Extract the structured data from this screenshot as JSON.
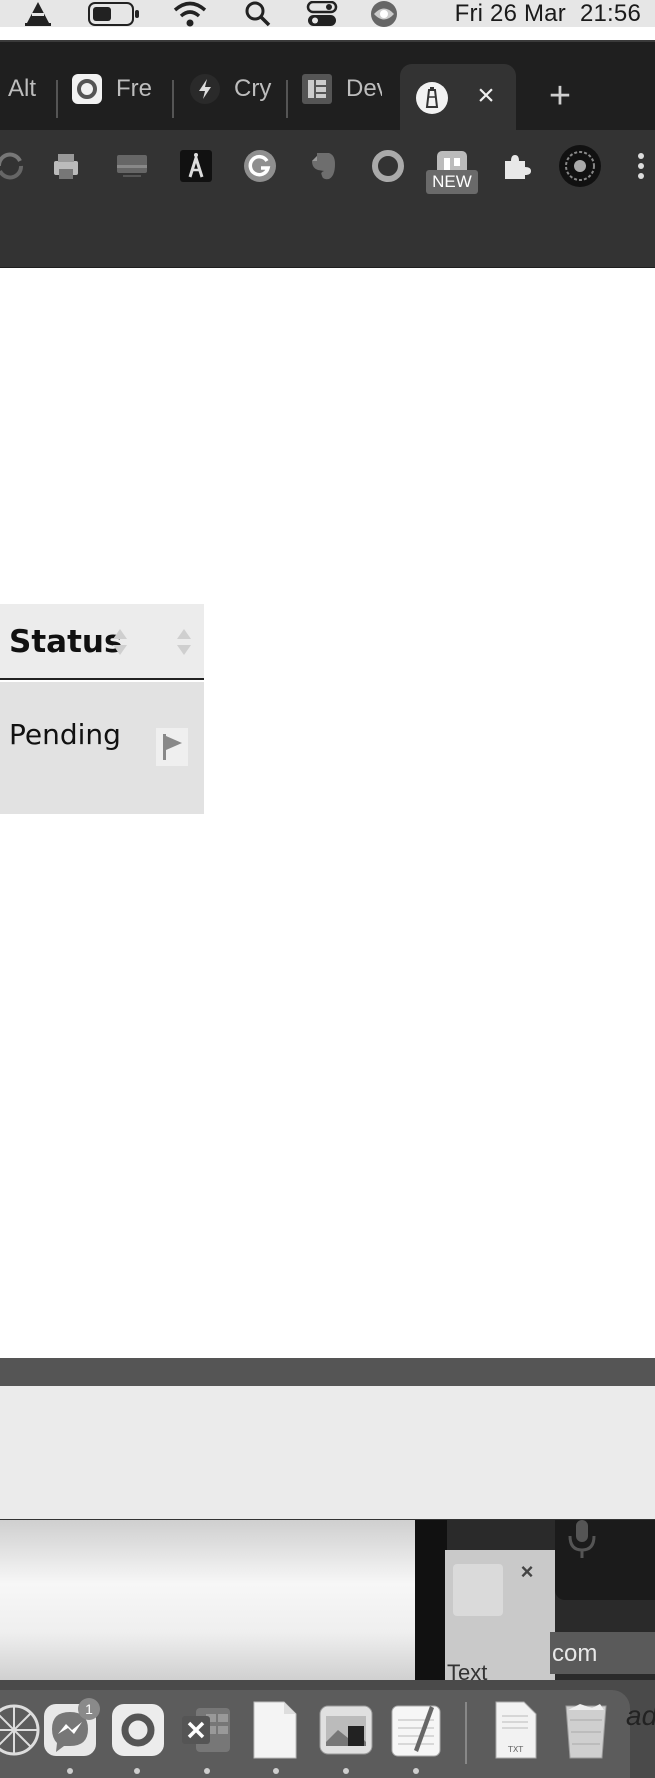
{
  "menubar": {
    "date": "Fri 26 Mar",
    "time": "21:56",
    "icons": [
      "vlc-icon",
      "battery-icon",
      "wifi-icon",
      "spotlight-search-icon",
      "control-center-icon",
      "siri-icon"
    ]
  },
  "browser": {
    "tabs": [
      {
        "label": "Alt",
        "icon": "tab-favicon"
      },
      {
        "label": "Fre",
        "icon": "record-favicon"
      },
      {
        "label": "Cry",
        "icon": "bolt-favicon"
      },
      {
        "label": "Dev",
        "icon": "grid-favicon"
      }
    ],
    "active_tab": {
      "icon": "lighthouse-favicon",
      "close": "×"
    },
    "new_tab": "+",
    "extensions": [
      "sync-icon",
      "print-icon",
      "analytics-icon",
      "a-extension-icon",
      "grammarly-icon",
      "evernote-icon",
      "circle-extension-icon",
      "new-extension-icon",
      "puzzle-icon",
      "profile-avatar-icon",
      "more-icon"
    ],
    "new_badge": "NEW"
  },
  "table": {
    "header": "Status",
    "rows": [
      {
        "status": "Pending"
      }
    ]
  },
  "windows": {
    "text_card_label": "Text",
    "com_card_label": "com",
    "close": "×"
  },
  "dock": {
    "messenger_badge": "1",
    "edge_text": "ad",
    "apps": [
      "chrome-spider-icon",
      "messenger-icon",
      "record-app-icon",
      "excel-icon",
      "blank-document-icon",
      "preview-icon",
      "textedit-icon",
      "txt-file-icon",
      "trash-icon"
    ]
  },
  "colors": {
    "tabstrip": "#1f1f1f",
    "toolbar": "#333333",
    "header_bg": "#ececec",
    "row_bg": "#e2e2e2"
  }
}
